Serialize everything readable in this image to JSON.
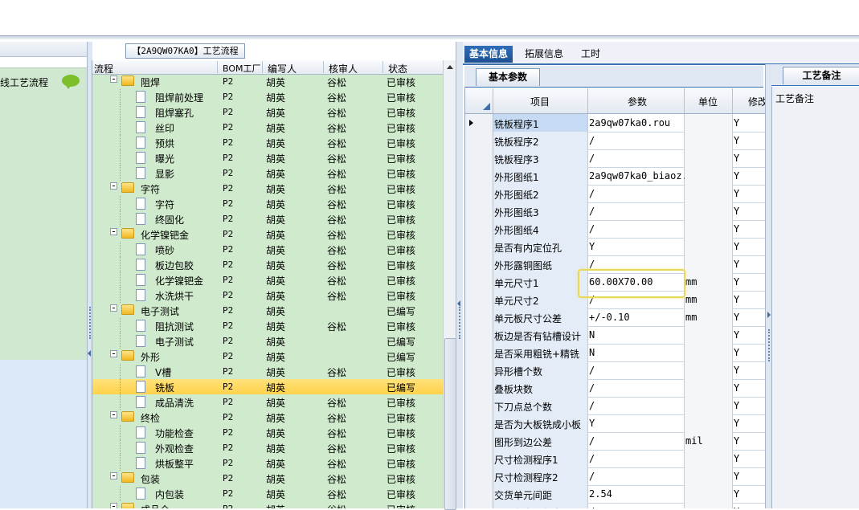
{
  "left_nav": {
    "item_label": "线工艺流程"
  },
  "process_title": "【2A9QW07KA0】工艺流程",
  "tree": {
    "columns": [
      "流程",
      "BOM工厂",
      "编写人",
      "核审人",
      "状态"
    ],
    "rows": [
      {
        "name": "阻焊",
        "type": "folder",
        "level": 0,
        "bom": "P2",
        "author": "胡英",
        "reviewer": "谷松",
        "status": "已审核"
      },
      {
        "name": "阻焊前处理",
        "type": "doc",
        "level": 1,
        "bom": "P2",
        "author": "胡英",
        "reviewer": "谷松",
        "status": "已审核"
      },
      {
        "name": "阻焊塞孔",
        "type": "doc",
        "level": 1,
        "bom": "P2",
        "author": "胡英",
        "reviewer": "谷松",
        "status": "已审核"
      },
      {
        "name": "丝印",
        "type": "doc",
        "level": 1,
        "bom": "P2",
        "author": "胡英",
        "reviewer": "谷松",
        "status": "已审核"
      },
      {
        "name": "预烘",
        "type": "doc",
        "level": 1,
        "bom": "P2",
        "author": "胡英",
        "reviewer": "谷松",
        "status": "已审核"
      },
      {
        "name": "曝光",
        "type": "doc",
        "level": 1,
        "bom": "P2",
        "author": "胡英",
        "reviewer": "谷松",
        "status": "已审核"
      },
      {
        "name": "显影",
        "type": "doc",
        "level": 1,
        "bom": "P2",
        "author": "胡英",
        "reviewer": "谷松",
        "status": "已审核"
      },
      {
        "name": "字符",
        "type": "folder",
        "level": 0,
        "bom": "P2",
        "author": "胡英",
        "reviewer": "谷松",
        "status": "已审核"
      },
      {
        "name": "字符",
        "type": "doc",
        "level": 1,
        "bom": "P2",
        "author": "胡英",
        "reviewer": "谷松",
        "status": "已审核"
      },
      {
        "name": "终固化",
        "type": "doc",
        "level": 1,
        "bom": "P2",
        "author": "胡英",
        "reviewer": "谷松",
        "status": "已审核"
      },
      {
        "name": "化学镍钯金",
        "type": "folder",
        "level": 0,
        "bom": "P2",
        "author": "胡英",
        "reviewer": "谷松",
        "status": "已审核"
      },
      {
        "name": "喷砂",
        "type": "doc",
        "level": 1,
        "bom": "P2",
        "author": "胡英",
        "reviewer": "谷松",
        "status": "已审核"
      },
      {
        "name": "板边包胶",
        "type": "doc",
        "level": 1,
        "bom": "P2",
        "author": "胡英",
        "reviewer": "谷松",
        "status": "已审核"
      },
      {
        "name": "化学镍钯金",
        "type": "doc",
        "level": 1,
        "bom": "P2",
        "author": "胡英",
        "reviewer": "谷松",
        "status": "已审核"
      },
      {
        "name": "水洗烘干",
        "type": "doc",
        "level": 1,
        "bom": "P2",
        "author": "胡英",
        "reviewer": "谷松",
        "status": "已审核"
      },
      {
        "name": "电子测试",
        "type": "folder",
        "level": 0,
        "bom": "P2",
        "author": "胡英",
        "reviewer": "",
        "status": "已编写"
      },
      {
        "name": "阻抗测试",
        "type": "doc",
        "level": 1,
        "bom": "P2",
        "author": "胡英",
        "reviewer": "谷松",
        "status": "已审核"
      },
      {
        "name": "电子测试",
        "type": "doc",
        "level": 1,
        "bom": "P2",
        "author": "胡英",
        "reviewer": "",
        "status": "已编写"
      },
      {
        "name": "外形",
        "type": "folder",
        "level": 0,
        "bom": "P2",
        "author": "胡英",
        "reviewer": "",
        "status": "已编写"
      },
      {
        "name": "V槽",
        "type": "doc",
        "level": 1,
        "bom": "P2",
        "author": "胡英",
        "reviewer": "谷松",
        "status": "已审核"
      },
      {
        "name": "铣板",
        "type": "doc",
        "level": 1,
        "bom": "P2",
        "author": "胡英",
        "reviewer": "",
        "status": "已编写",
        "selected": true
      },
      {
        "name": "成品清洗",
        "type": "doc",
        "level": 1,
        "bom": "P2",
        "author": "胡英",
        "reviewer": "谷松",
        "status": "已审核"
      },
      {
        "name": "终检",
        "type": "folder",
        "level": 0,
        "bom": "P2",
        "author": "胡英",
        "reviewer": "谷松",
        "status": "已审核"
      },
      {
        "name": "功能检查",
        "type": "doc",
        "level": 1,
        "bom": "P2",
        "author": "胡英",
        "reviewer": "谷松",
        "status": "已审核"
      },
      {
        "name": "外观检查",
        "type": "doc",
        "level": 1,
        "bom": "P2",
        "author": "胡英",
        "reviewer": "谷松",
        "status": "已审核"
      },
      {
        "name": "烘板整平",
        "type": "doc",
        "level": 1,
        "bom": "P2",
        "author": "胡英",
        "reviewer": "谷松",
        "status": "已审核"
      },
      {
        "name": "包装",
        "type": "folder",
        "level": 0,
        "bom": "P2",
        "author": "胡英",
        "reviewer": "谷松",
        "status": "已审核"
      },
      {
        "name": "内包装",
        "type": "doc",
        "level": 1,
        "bom": "P2",
        "author": "胡英",
        "reviewer": "谷松",
        "status": "已审核"
      },
      {
        "name": "成品仓",
        "type": "folder",
        "level": 0,
        "bom": "P2",
        "author": "胡英",
        "reviewer": "谷松",
        "status": "已审核"
      }
    ]
  },
  "right_tabs": [
    "基本信息",
    "拓展信息",
    "工时"
  ],
  "base_params_tab": "基本参数",
  "params": {
    "columns": [
      "项目",
      "参数",
      "单位",
      "修改"
    ],
    "rows": [
      {
        "item": "铣板程序1",
        "value": "2a9qw07ka0.rou",
        "unit": "",
        "mod": "Y",
        "current": true
      },
      {
        "item": "铣板程序2",
        "value": "/",
        "unit": "",
        "mod": "Y"
      },
      {
        "item": "铣板程序3",
        "value": "/",
        "unit": "",
        "mod": "Y"
      },
      {
        "item": "外形图纸1",
        "value": "2a9qw07ka0_biaoz...",
        "unit": "",
        "mod": "Y"
      },
      {
        "item": "外形图纸2",
        "value": "/",
        "unit": "",
        "mod": "Y"
      },
      {
        "item": "外形图纸3",
        "value": "/",
        "unit": "",
        "mod": "Y"
      },
      {
        "item": "外形图纸4",
        "value": "/",
        "unit": "",
        "mod": "Y"
      },
      {
        "item": "是否有内定位孔",
        "value": "Y",
        "unit": "",
        "mod": "Y"
      },
      {
        "item": "外形露铜图纸",
        "value": "/",
        "unit": "",
        "mod": "Y"
      },
      {
        "item": "单元尺寸1",
        "value": "60.00X70.00",
        "unit": "mm",
        "mod": "Y"
      },
      {
        "item": "单元尺寸2",
        "value": "/",
        "unit": "mm",
        "mod": "Y"
      },
      {
        "item": "单元板尺寸公差",
        "value": "+/-0.10",
        "unit": "mm",
        "mod": "Y"
      },
      {
        "item": "板边是否有钻槽设计",
        "value": "N",
        "unit": "",
        "mod": "Y"
      },
      {
        "item": "是否采用粗铣+精铣",
        "value": "N",
        "unit": "",
        "mod": "Y"
      },
      {
        "item": "异形槽个数",
        "value": "/",
        "unit": "",
        "mod": "Y"
      },
      {
        "item": "叠板块数",
        "value": "/",
        "unit": "",
        "mod": "Y"
      },
      {
        "item": "下刀点总个数",
        "value": "/",
        "unit": "",
        "mod": "Y"
      },
      {
        "item": "是否为大板铣成小板",
        "value": "Y",
        "unit": "",
        "mod": "Y"
      },
      {
        "item": "图形到边公差",
        "value": "/",
        "unit": "mil",
        "mod": "Y"
      },
      {
        "item": "尺寸检测程序1",
        "value": "/",
        "unit": "",
        "mod": "Y"
      },
      {
        "item": "尺寸检测程序2",
        "value": "/",
        "unit": "",
        "mod": "Y"
      },
      {
        "item": "交货单元间距",
        "value": "2.54",
        "unit": "",
        "mod": "Y"
      },
      {
        "item": "是否有金属化半孔",
        "value": "/",
        "unit": "",
        "mod": "Y"
      }
    ]
  },
  "notes_tab": "工艺备注",
  "notes_header": "工艺备注",
  "colors": {
    "tree_bg": "#cfeacc",
    "selected_row": "#ffd24a",
    "active_tab": "#2f6db8"
  }
}
